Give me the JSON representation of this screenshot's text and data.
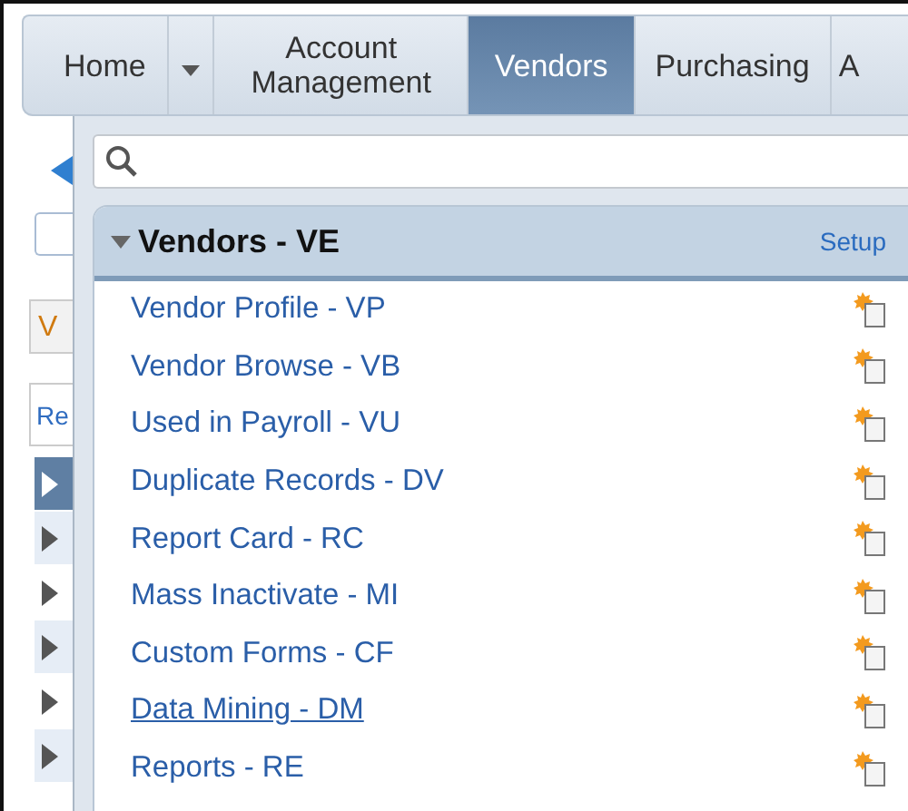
{
  "nav_tabs": [
    {
      "label": "Home",
      "selected": false,
      "kind": "tab"
    },
    {
      "selected": false,
      "kind": "dropdown"
    },
    {
      "label": "Account Management",
      "selected": false,
      "kind": "tab"
    },
    {
      "label": "Vendors",
      "selected": true,
      "kind": "tab"
    },
    {
      "label": "Purchasing",
      "selected": false,
      "kind": "tab"
    },
    {
      "label": "A",
      "selected": false,
      "kind": "tab"
    }
  ],
  "left_panel": {
    "tab_1": "V",
    "tab_2": "Re",
    "rows": [
      {
        "selected": true
      },
      {
        "selected": false
      },
      {
        "selected": false
      },
      {
        "selected": false
      },
      {
        "selected": false
      },
      {
        "selected": false
      }
    ]
  },
  "menu": {
    "title": "Vendors - VE",
    "setup_link": "Setup",
    "items": [
      {
        "label": "Vendor Profile - VP",
        "hovered": false
      },
      {
        "label": "Vendor Browse - VB",
        "hovered": false
      },
      {
        "label": "Used in Payroll - VU",
        "hovered": false
      },
      {
        "label": "Duplicate Records - DV",
        "hovered": false
      },
      {
        "label": "Report Card - RC",
        "hovered": false
      },
      {
        "label": "Mass Inactivate - MI",
        "hovered": false
      },
      {
        "label": "Custom Forms - CF",
        "hovered": false
      },
      {
        "label": "Data Mining - DM",
        "hovered": true
      },
      {
        "label": "Reports - RE",
        "hovered": false
      }
    ]
  }
}
